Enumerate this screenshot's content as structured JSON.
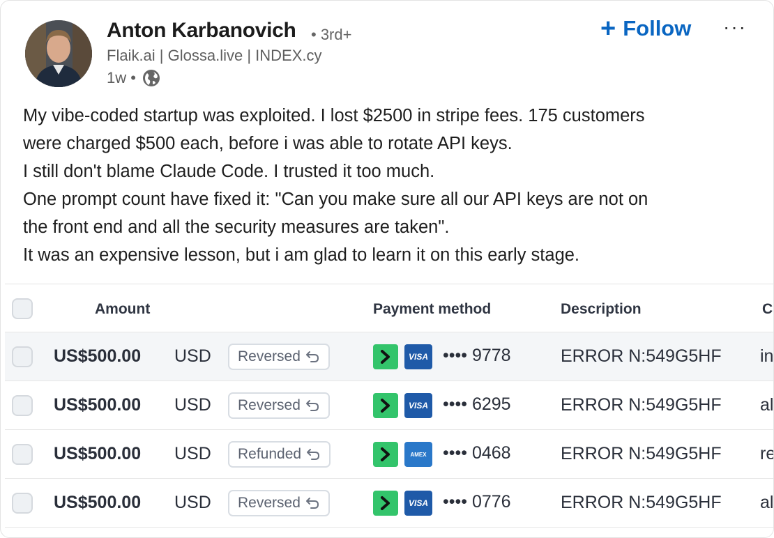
{
  "author": {
    "name": "Anton Karbanovich",
    "degree": "• 3rd+",
    "headline": "Flaik.ai | Glossa.live | INDEX.cy",
    "time": "1w •"
  },
  "actions": {
    "follow_icon": "+",
    "follow_label": "Follow",
    "more_label": "···"
  },
  "post": {
    "lines": [
      "My vibe-coded startup was exploited. I lost $2500 in stripe fees. 175 customers",
      "were charged $500 each, before i was able to rotate API keys.",
      "I still don't blame Claude Code. I trusted it too much.",
      "One prompt count have fixed it: \"Can you make sure all our API keys are not on",
      "the front end and all the security measures are taken\".",
      "It was an expensive lesson, but i am glad to learn it on this early stage."
    ]
  },
  "table": {
    "headers": {
      "amount": "Amount",
      "payment_method": "Payment method",
      "description": "Description",
      "customer": "C"
    },
    "rows": [
      {
        "amount": "US$500.00",
        "currency": "USD",
        "status": "Reversed",
        "card": "VISA",
        "last4": "•••• 9778",
        "description": "ERROR N:549G5HF",
        "tail": "in"
      },
      {
        "amount": "US$500.00",
        "currency": "USD",
        "status": "Reversed",
        "card": "VISA",
        "last4": "•••• 6295",
        "description": "ERROR N:549G5HF",
        "tail": "al"
      },
      {
        "amount": "US$500.00",
        "currency": "USD",
        "status": "Refunded",
        "card": "AMEX",
        "last4": "•••• 0468",
        "description": "ERROR N:549G5HF",
        "tail": "re"
      },
      {
        "amount": "US$500.00",
        "currency": "USD",
        "status": "Reversed",
        "card": "VISA",
        "last4": "•••• 0776",
        "description": "ERROR N:549G5HF",
        "tail": "al"
      }
    ]
  },
  "colors": {
    "follow": "#0a66c2",
    "link_green": "#33c46b",
    "visa_blue": "#1f5aa8",
    "amex_blue": "#2a78c9"
  }
}
